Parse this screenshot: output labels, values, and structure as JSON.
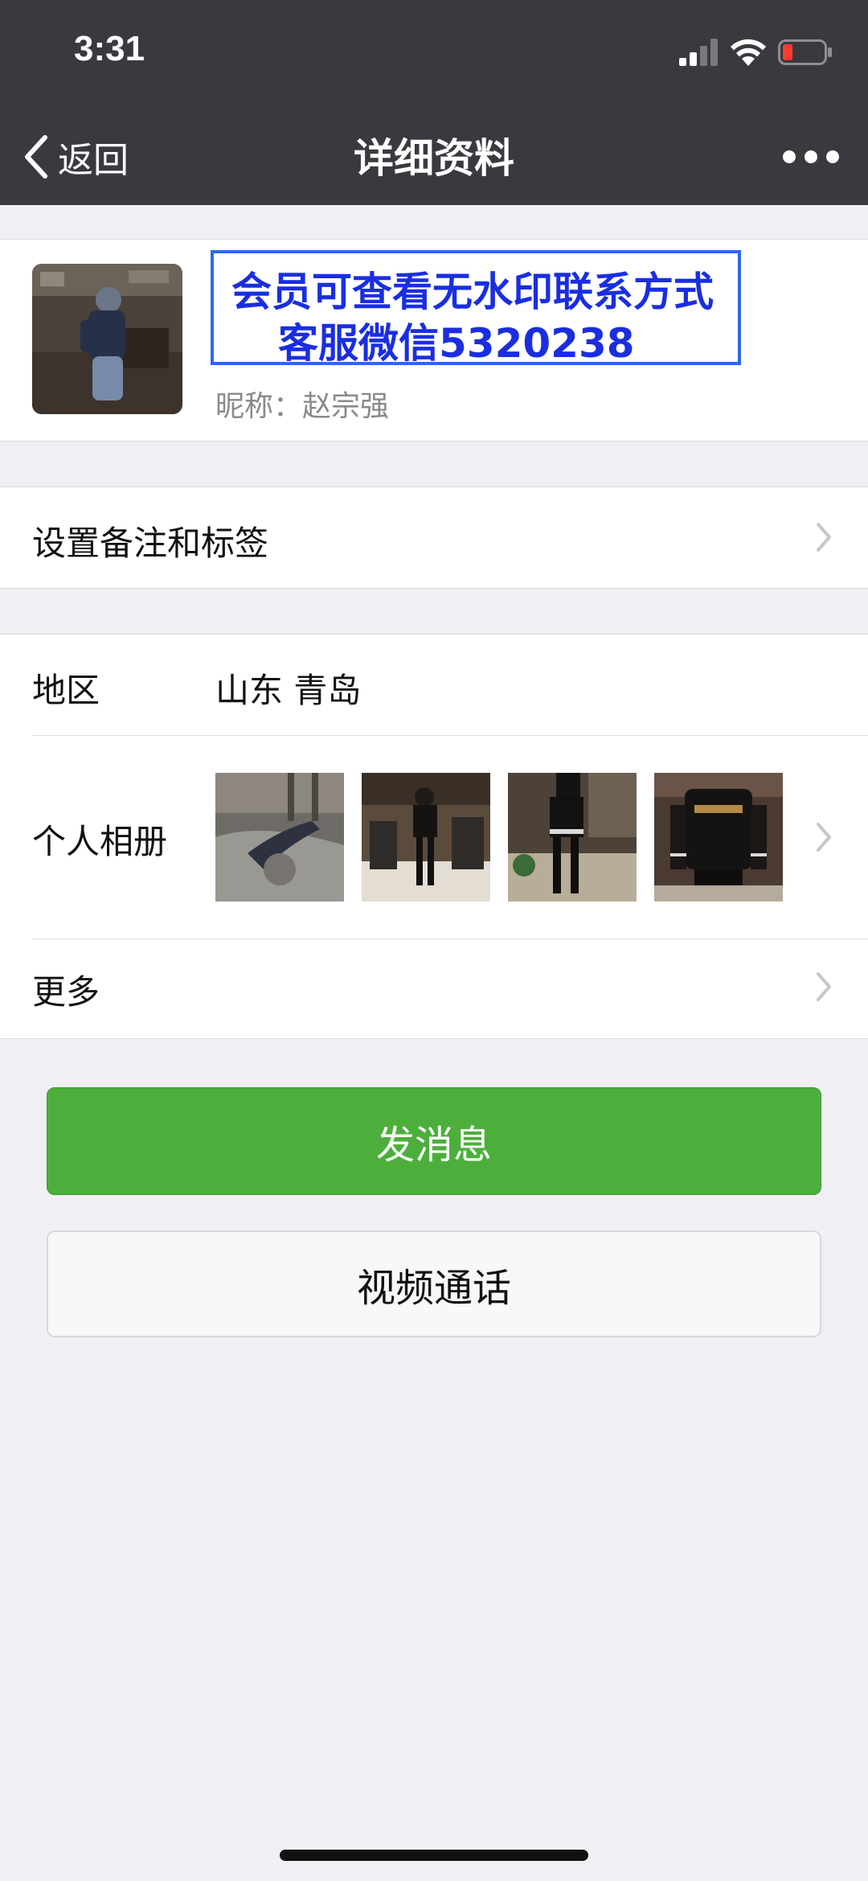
{
  "status_bar": {
    "time": "3:31"
  },
  "nav": {
    "back_label": "返回",
    "title": "详细资料"
  },
  "profile": {
    "watermark_line1": "会员可查看无水印联系方式",
    "watermark_line2": "客服微信5320238",
    "nickname": "昵称：赵宗强"
  },
  "rows": {
    "remark_label": "设置备注和标签",
    "region_label": "地区",
    "region_value": "山东  青岛",
    "album_label": "个人相册",
    "more_label": "更多"
  },
  "buttons": {
    "message": "发消息",
    "video_call": "视频通话"
  },
  "colors": {
    "nav_bg": "#393a3f",
    "primary_green": "#4caf3c",
    "watermark_blue": "#1a2ee0",
    "page_bg": "#efeff4"
  }
}
